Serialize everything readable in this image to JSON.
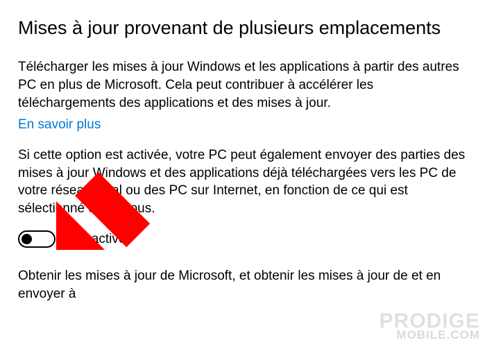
{
  "title": "Mises à jour provenant de plusieurs emplacements",
  "intro": "Télécharger les mises à jour Windows et les applications à partir des autres PC en plus de Microsoft. Cela peut contribuer à accélérer les téléchargements des applications et des mises à jour.",
  "learn_more": "En savoir plus",
  "details": "Si cette option est activée, votre PC peut également envoyer des parties des mises à jour Windows et des applications déjà téléchargées vers les PC de votre réseau local ou des PC sur Internet, en fonction de ce qui est sélectionné ci-dessous.",
  "toggle": {
    "state": "off",
    "label": "Désactivé"
  },
  "footer": "Obtenir les mises à jour de Microsoft, et obtenir les mises à jour de et en envoyer à",
  "watermark": {
    "line1": "PRODIGE",
    "line2": "MOBILE.COM"
  },
  "annotation": {
    "arrow_color": "#ff0000"
  }
}
